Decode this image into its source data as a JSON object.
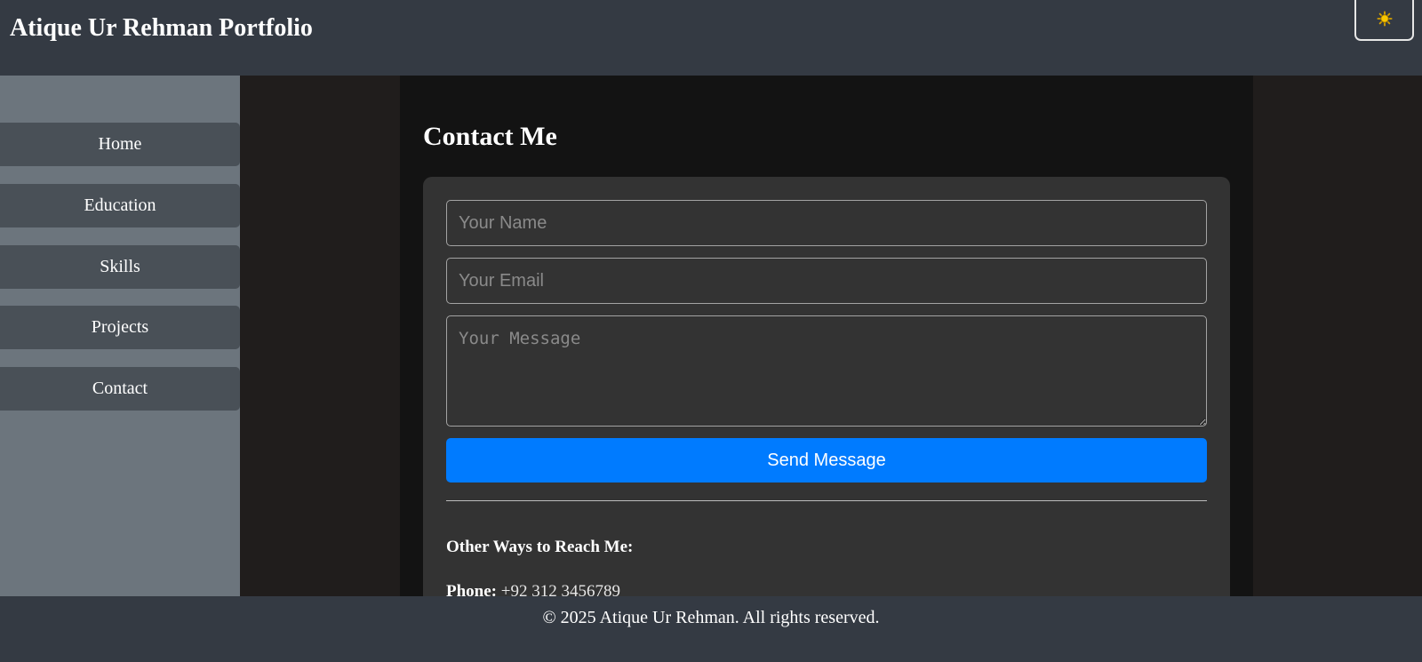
{
  "header": {
    "title": "Atique Ur Rehman Portfolio",
    "theme_toggle_icon": "sun-icon"
  },
  "sidebar": {
    "items": [
      {
        "label": "Home"
      },
      {
        "label": "Education"
      },
      {
        "label": "Skills"
      },
      {
        "label": "Projects"
      },
      {
        "label": "Contact"
      }
    ]
  },
  "contact": {
    "title": "Contact Me",
    "name_placeholder": "Your Name",
    "email_placeholder": "Your Email",
    "message_placeholder": "Your Message",
    "send_label": "Send Message",
    "other_heading": "Other Ways to Reach Me:",
    "phone_label": "Phone:",
    "phone_value": "+92 312 3456789"
  },
  "footer": {
    "text": "© 2025 Atique Ur Rehman. All rights reserved."
  },
  "colors": {
    "header_bg": "#343a43",
    "sidebar_bg": "#6c757d",
    "nav_item_bg": "#495057",
    "page_bg": "#201d1c",
    "panel_bg": "#131313",
    "card_bg": "#333333",
    "accent": "#007bff"
  }
}
